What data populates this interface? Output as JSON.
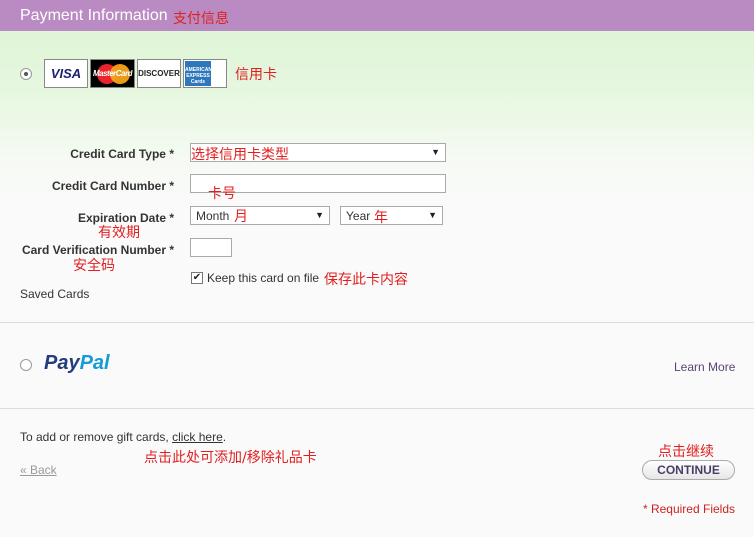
{
  "header": {
    "title": "Payment Information",
    "title_annotation": "支付信息"
  },
  "credit_card": {
    "cards": [
      "VISA",
      "MasterCard",
      "DISCOVER",
      "AMERICAN EXPRESS Cards"
    ],
    "cards_annotation": "信用卡",
    "fields": {
      "type_label": "Credit Card Type *",
      "type_annotation": "选择信用卡类型",
      "number_label": "Credit Card Number *",
      "number_annotation": "卡号",
      "expiration_label": "Expiration Date *",
      "expiration_annotation": "有效期",
      "month_value": "Month",
      "month_annotation": "月",
      "year_value": "Year",
      "year_annotation": "年",
      "cvn_label": "Card Verification Number *",
      "cvn_annotation": "安全码",
      "keep_label": "Keep this card on file",
      "keep_annotation": "保存此卡内容",
      "saved_cards_label": "Saved Cards"
    }
  },
  "paypal": {
    "brand_1": "Pay",
    "brand_2": "Pal",
    "learn_more": "Learn More"
  },
  "footer": {
    "gift_text": "To add or remove gift cards, ",
    "gift_link": "click here",
    "gift_period": ".",
    "gift_annotation": "点击此处可添加/移除礼品卡",
    "back_label": "« Back",
    "continue_annotation": "点击继续",
    "continue_label": "CONTINUE",
    "required_note": "* Required Fields"
  },
  "colors": {
    "header": "#b98bc2",
    "annotation": "#e02020",
    "link": "#5a4378"
  }
}
